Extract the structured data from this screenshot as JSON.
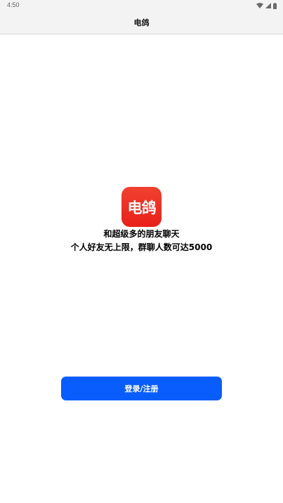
{
  "status_bar": {
    "time": "4:50",
    "icons": [
      "wifi-icon",
      "signal-icon",
      "battery-icon"
    ]
  },
  "header": {
    "title": "电鸽"
  },
  "app_logo": {
    "text": "电鸽",
    "color": "#e8201a"
  },
  "tagline": {
    "line1": "和超级多的朋友聊天",
    "line2": "个人好友无上限，群聊人数可达5000"
  },
  "login": {
    "label": "登录/注册",
    "color": "#0a5dfd"
  }
}
